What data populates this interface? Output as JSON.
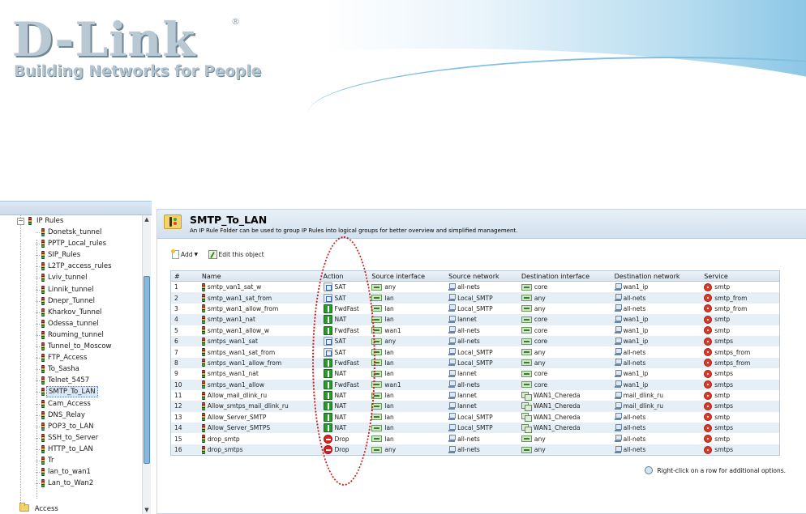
{
  "brand": {
    "logo_text": "D-Link",
    "registered": "®",
    "tagline": "Building Networks for People"
  },
  "tree": {
    "root_label": "IP Rules",
    "items": [
      "Donetsk_tunnel",
      "PPTP_Local_rules",
      "SIP_Rules",
      "L2TP_access_rules",
      "Lviv_tunnel",
      "Linnik_tunnel",
      "Dnepr_Tunnel",
      "Kharkov_Tunnel",
      "Odessa_tunnel",
      "Rouming_tunnel",
      "Tunnel_to_Moscow",
      "FTP_Access",
      "To_Sasha",
      "Telnet_5457",
      "SMTP_To_LAN",
      "Cam_Access",
      "DNS_Relay",
      "POP3_to_LAN",
      "SSH_to_Server",
      "HTTP_to_LAN",
      "Tr",
      "lan_to_wan1",
      "Lan_to_Wan2"
    ],
    "selected": "SMTP_To_LAN",
    "bottom_label": "Access"
  },
  "main": {
    "title": "SMTP_To_LAN",
    "description": "An IP Rule Folder can be used to group IP Rules into logical groups for better overview and simplified management.",
    "toolbar": {
      "add_label": "Add",
      "edit_label": "Edit this object"
    },
    "columns": [
      "#",
      "Name",
      "Action",
      "Source interface",
      "Source network",
      "Destination interface",
      "Destination network",
      "Service"
    ],
    "rows": [
      {
        "n": "1",
        "name": "smtp_van1_sat_w",
        "action": "SAT",
        "atype": "sat",
        "src_if": "any",
        "src_net": "all-nets",
        "dst_if": "core",
        "dst_if_type": "if",
        "dst_net": "wan1_ip",
        "service": "smtp"
      },
      {
        "n": "2",
        "name": "smtp_wan1_sat_from",
        "action": "SAT",
        "atype": "sat",
        "src_if": "lan",
        "src_net": "Local_SMTP",
        "dst_if": "any",
        "dst_if_type": "if",
        "dst_net": "all-nets",
        "service": "smtp_from"
      },
      {
        "n": "3",
        "name": "smtp_wan1_allow_from",
        "action": "FwdFast",
        "atype": "fwd",
        "src_if": "lan",
        "src_net": "Local_SMTP",
        "dst_if": "any",
        "dst_if_type": "if",
        "dst_net": "all-nets",
        "service": "smtp_from"
      },
      {
        "n": "4",
        "name": "smtp_wan1_nat",
        "action": "NAT",
        "atype": "nat",
        "src_if": "lan",
        "src_net": "lannet",
        "dst_if": "core",
        "dst_if_type": "if",
        "dst_net": "wan1_ip",
        "service": "smtp"
      },
      {
        "n": "5",
        "name": "smtp_wan1_allow_w",
        "action": "FwdFast",
        "atype": "fwd",
        "src_if": "wan1",
        "src_net": "all-nets",
        "dst_if": "core",
        "dst_if_type": "if",
        "dst_net": "wan1_ip",
        "service": "smtp"
      },
      {
        "n": "6",
        "name": "smtps_wan1_sat",
        "action": "SAT",
        "atype": "sat",
        "src_if": "any",
        "src_net": "all-nets",
        "dst_if": "core",
        "dst_if_type": "if",
        "dst_net": "wan1_ip",
        "service": "smtps"
      },
      {
        "n": "7",
        "name": "smtps_wan1_sat_from",
        "action": "SAT",
        "atype": "sat",
        "src_if": "lan",
        "src_net": "Local_SMTP",
        "dst_if": "any",
        "dst_if_type": "if",
        "dst_net": "all-nets",
        "service": "smtps_from"
      },
      {
        "n": "8",
        "name": "smtps_wan1_allow_from",
        "action": "FwdFast",
        "atype": "fwd",
        "src_if": "lan",
        "src_net": "Local_SMTP",
        "dst_if": "any",
        "dst_if_type": "if",
        "dst_net": "all-nets",
        "service": "smtps_from"
      },
      {
        "n": "9",
        "name": "smtps_wan1_nat",
        "action": "NAT",
        "atype": "nat",
        "src_if": "lan",
        "src_net": "lannet",
        "dst_if": "core",
        "dst_if_type": "if",
        "dst_net": "wan1_ip",
        "service": "smtps"
      },
      {
        "n": "10",
        "name": "smtps_wan1_allow",
        "action": "FwdFast",
        "atype": "fwd",
        "src_if": "wan1",
        "src_net": "all-nets",
        "dst_if": "core",
        "dst_if_type": "if",
        "dst_net": "wan1_ip",
        "service": "smtps"
      },
      {
        "n": "11",
        "name": "Allow_mail_dlink_ru",
        "action": "NAT",
        "atype": "nat",
        "src_if": "lan",
        "src_net": "lannet",
        "dst_if": "WAN1_Chereda",
        "dst_if_type": "grp",
        "dst_net": "mail_dlink_ru",
        "service": "smtp"
      },
      {
        "n": "12",
        "name": "Allow_smtps_mail_dlink_ru",
        "action": "NAT",
        "atype": "nat",
        "src_if": "lan",
        "src_net": "lannet",
        "dst_if": "WAN1_Chereda",
        "dst_if_type": "grp",
        "dst_net": "mail_dlink_ru",
        "service": "smtps"
      },
      {
        "n": "13",
        "name": "Allow_Server_SMTP",
        "action": "NAT",
        "atype": "nat",
        "src_if": "lan",
        "src_net": "Local_SMTP",
        "dst_if": "WAN1_Chereda",
        "dst_if_type": "grp",
        "dst_net": "all-nets",
        "service": "smtp"
      },
      {
        "n": "14",
        "name": "Allow_Server_SMTPS",
        "action": "NAT",
        "atype": "nat",
        "src_if": "lan",
        "src_net": "Local_SMTP",
        "dst_if": "WAN1_Chereda",
        "dst_if_type": "grp",
        "dst_net": "all-nets",
        "service": "smtps"
      },
      {
        "n": "15",
        "name": "drop_smtp",
        "action": "Drop",
        "atype": "drop",
        "src_if": "lan",
        "src_net": "all-nets",
        "dst_if": "any",
        "dst_if_type": "if",
        "dst_net": "all-nets",
        "service": "smtp"
      },
      {
        "n": "16",
        "name": "drop_smtps",
        "action": "Drop",
        "atype": "drop",
        "src_if": "any",
        "src_net": "all-nets",
        "dst_if": "any",
        "dst_if_type": "if",
        "dst_net": "all-nets",
        "service": "smtps"
      }
    ],
    "hint": "Right-click on a row for additional options."
  },
  "colors": {
    "annotation": "#c81b1b",
    "row_alt": "#e6eff6",
    "header_bg": "#d2e1ee"
  }
}
